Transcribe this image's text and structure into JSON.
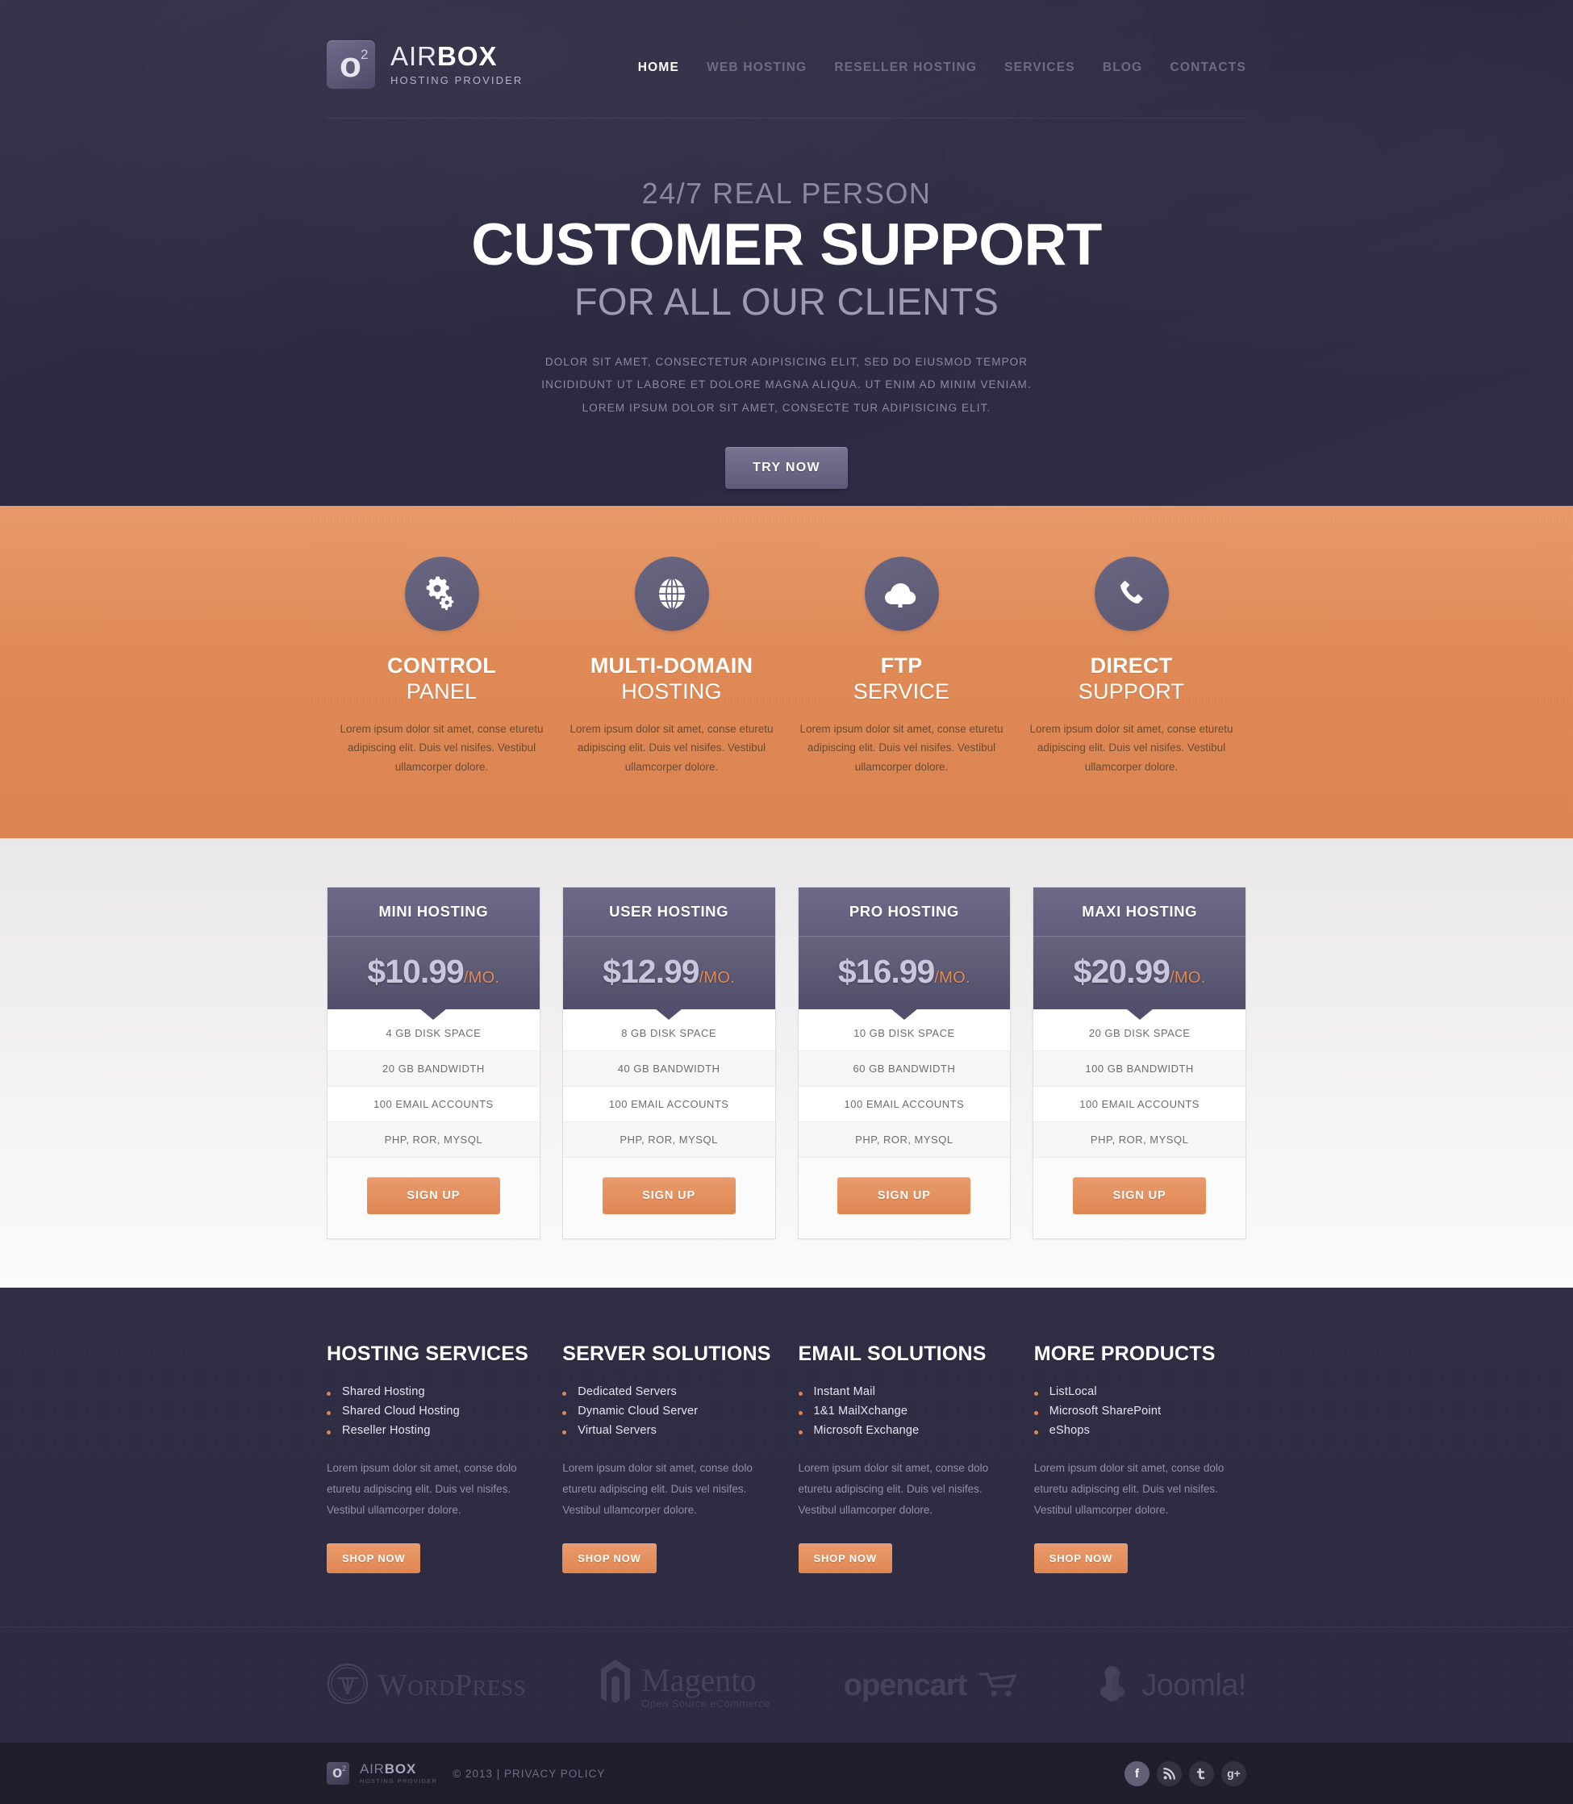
{
  "header": {
    "logo": {
      "o": "o",
      "sup": "2",
      "name_light": "AIR",
      "name_bold": "BOX",
      "tagline": "HOSTING PROVIDER"
    },
    "nav": [
      {
        "label": "HOME",
        "active": true
      },
      {
        "label": "WEB HOSTING",
        "active": false
      },
      {
        "label": "RESELLER HOSTING",
        "active": false
      },
      {
        "label": "SERVICES",
        "active": false
      },
      {
        "label": "BLOG",
        "active": false
      },
      {
        "label": "CONTACTS",
        "active": false
      }
    ]
  },
  "hero": {
    "kicker": "24/7 REAL PERSON",
    "title": "CUSTOMER SUPPORT",
    "subtitle": "FOR ALL OUR CLIENTS",
    "paragraph": "DOLOR SIT AMET, CONSECTETUR ADIPISICING ELIT, SED DO EIUSMOD TEMPOR INCIDIDUNT UT LABORE ET DOLORE MAGNA ALIQUA. UT ENIM AD MINIM VENIAM. LOREM IPSUM DOLOR SIT AMET, CONSECTE TUR ADIPISICING ELIT.",
    "cta": "TRY NOW"
  },
  "features": [
    {
      "icon": "gears-icon",
      "title_bold": "CONTROL",
      "title_thin": "PANEL",
      "text": "Lorem ipsum dolor sit amet, conse eturetu adipiscing elit. Duis vel nisifes. Vestibul ullamcorper dolore."
    },
    {
      "icon": "globe-icon",
      "title_bold": "MULTI-DOMAIN",
      "title_thin": "HOSTING",
      "text": "Lorem ipsum dolor sit amet, conse eturetu adipiscing elit. Duis vel nisifes. Vestibul ullamcorper dolore."
    },
    {
      "icon": "cloud-upload-icon",
      "title_bold": "FTP",
      "title_thin": "SERVICE",
      "text": "Lorem ipsum dolor sit amet, conse eturetu adipiscing elit. Duis vel nisifes. Vestibul ullamcorper dolore."
    },
    {
      "icon": "phone-icon",
      "title_bold": "DIRECT",
      "title_thin": "SUPPORT",
      "text": "Lorem ipsum dolor sit amet, conse eturetu adipiscing elit. Duis vel nisifes. Vestibul ullamcorper dolore."
    }
  ],
  "pricing": {
    "signup_label": "SIGN UP",
    "plans": [
      {
        "name": "MINI HOSTING",
        "price": "$10.99",
        "period": "/MO.",
        "features": [
          "4 GB DISK SPACE",
          "20 GB BANDWIDTH",
          "100 EMAIL ACCOUNTS",
          "PHP, ROR, MYSQL"
        ]
      },
      {
        "name": "USER HOSTING",
        "price": "$12.99",
        "period": "/MO.",
        "features": [
          "8 GB DISK SPACE",
          "40 GB BANDWIDTH",
          "100 EMAIL ACCOUNTS",
          "PHP, ROR, MYSQL"
        ]
      },
      {
        "name": "PRO HOSTING",
        "price": "$16.99",
        "period": "/MO.",
        "features": [
          "10 GB DISK SPACE",
          "60 GB BANDWIDTH",
          "100 EMAIL ACCOUNTS",
          "PHP, ROR, MYSQL"
        ]
      },
      {
        "name": "MAXI HOSTING",
        "price": "$20.99",
        "period": "/MO.",
        "features": [
          "20 GB DISK SPACE",
          "100 GB BANDWIDTH",
          "100 EMAIL ACCOUNTS",
          "PHP, ROR, MYSQL"
        ]
      }
    ]
  },
  "footer": {
    "shop_label": "SHOP NOW",
    "columns": [
      {
        "heading": "HOSTING SERVICES",
        "links": [
          "Shared Hosting",
          "Shared Cloud Hosting",
          "Reseller Hosting"
        ],
        "text": "Lorem ipsum dolor sit amet, conse dolo eturetu adipiscing elit. Duis vel nisifes. Vestibul ullamcorper dolore."
      },
      {
        "heading": "SERVER SOLUTIONS",
        "links": [
          "Dedicated Servers",
          "Dynamic Cloud Server",
          "Virtual Servers"
        ],
        "text": "Lorem ipsum dolor sit amet, conse dolo eturetu adipiscing elit. Duis vel nisifes. Vestibul ullamcorper dolore."
      },
      {
        "heading": "EMAIL SOLUTIONS",
        "links": [
          "Instant Mail",
          "1&1 MailXchange",
          "Microsoft Exchange"
        ],
        "text": "Lorem ipsum dolor sit amet, conse dolo eturetu adipiscing elit. Duis vel nisifes. Vestibul ullamcorper dolore."
      },
      {
        "heading": "MORE PRODUCTS",
        "links": [
          "ListLocal",
          "Microsoft SharePoint",
          "eShops"
        ],
        "text": "Lorem ipsum dolor sit amet, conse dolo eturetu adipiscing elit. Duis vel nisifes. Vestibul ullamcorper dolore."
      }
    ],
    "brands": [
      {
        "name": "WordPress",
        "icon": "wordpress-icon",
        "sub": ""
      },
      {
        "name": "Magento",
        "icon": "magento-icon",
        "sub": "Open Source eCommerce"
      },
      {
        "name": "opencart",
        "icon": "opencart-cart-icon",
        "sub": ""
      },
      {
        "name": "Joomla!",
        "icon": "joomla-icon",
        "sub": ""
      }
    ],
    "bottom": {
      "logo_o": "o",
      "logo_sup": "2",
      "name_light": "AIR",
      "name_bold": "BOX",
      "tagline": "HOSTING PROVIDER",
      "copyright": "© 2013  |  PRIVACY POLICY",
      "socials": [
        {
          "icon": "facebook-icon",
          "glyph": "f",
          "highlight": true
        },
        {
          "icon": "rss-icon",
          "glyph": "",
          "highlight": false
        },
        {
          "icon": "twitter-icon",
          "glyph": "",
          "highlight": false
        },
        {
          "icon": "google-plus-icon",
          "glyph": "g+",
          "highlight": false
        }
      ]
    }
  },
  "colors": {
    "accent_orange": "#e08a55",
    "dark_purple": "#2e2c42",
    "card_purple": "#615e7e"
  }
}
